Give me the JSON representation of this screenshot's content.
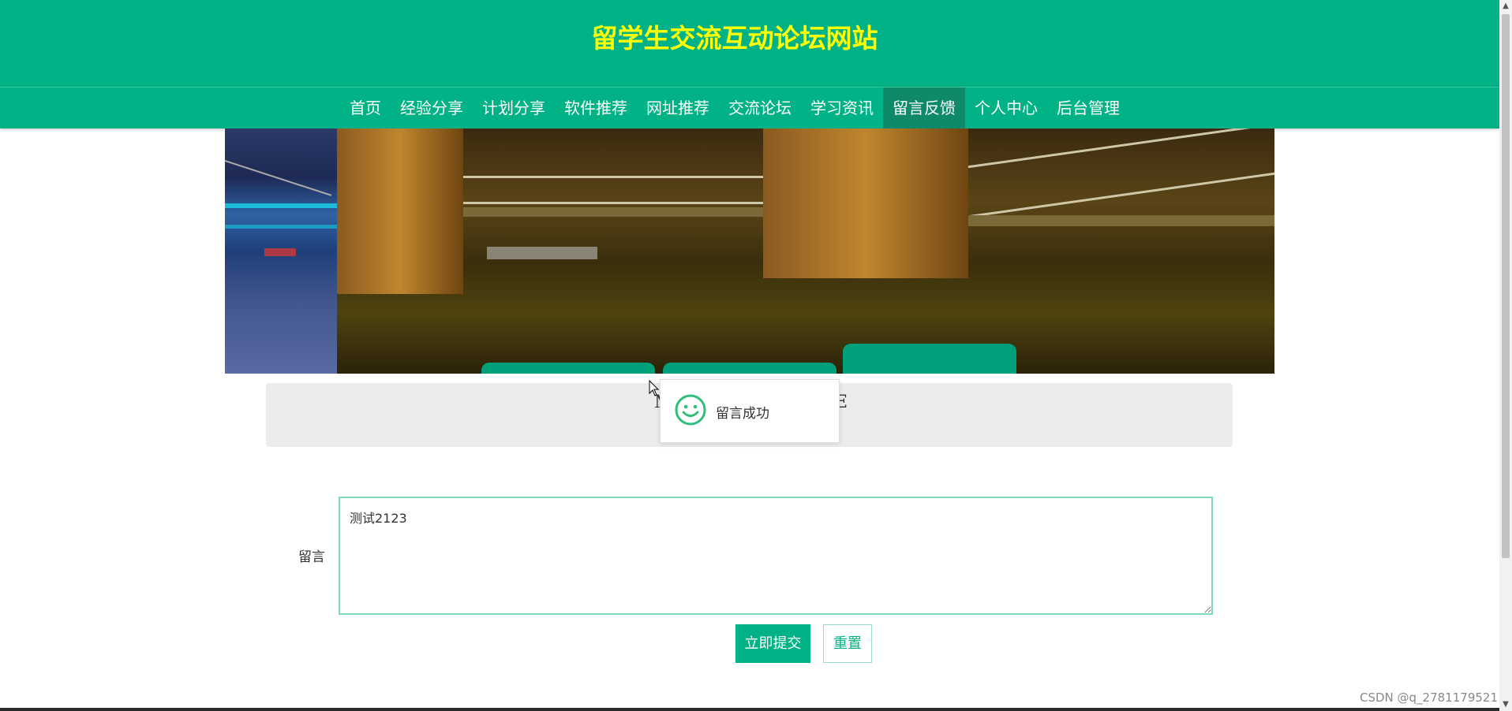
{
  "header": {
    "site_title": "留学生交流互动论坛网站"
  },
  "nav": {
    "items": [
      {
        "label": "首页"
      },
      {
        "label": "经验分享"
      },
      {
        "label": "计划分享"
      },
      {
        "label": "软件推荐"
      },
      {
        "label": "网址推荐"
      },
      {
        "label": "交流论坛"
      },
      {
        "label": "学习资讯"
      },
      {
        "label": "留言反馈",
        "active": true
      },
      {
        "label": "个人中心"
      },
      {
        "label": "后台管理"
      }
    ]
  },
  "section": {
    "title_left_fragment": "M",
    "title_right_fragment": "E"
  },
  "toast": {
    "icon": "smile-icon",
    "message": "留言成功"
  },
  "form": {
    "message_label": "留言",
    "message_value": "测试2123",
    "submit_label": "立即提交",
    "reset_label": "重置"
  },
  "watermark": "CSDN @q_2781179521",
  "colors": {
    "primary": "#00b285",
    "title": "#ffff00",
    "active_nav": "#0e8a6b"
  }
}
